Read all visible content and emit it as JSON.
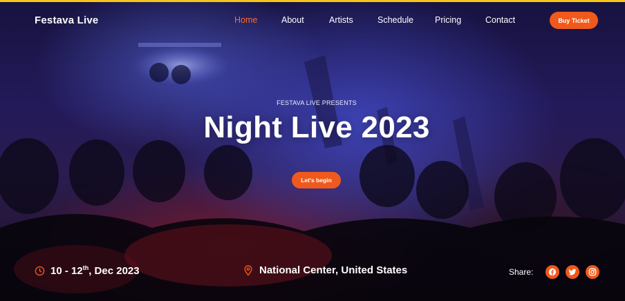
{
  "brand": "Festava Live",
  "nav": [
    {
      "label": "Home",
      "active": true
    },
    {
      "label": "About",
      "active": false
    },
    {
      "label": "Artists",
      "active": false
    },
    {
      "label": "Schedule",
      "active": false
    },
    {
      "label": "Pricing",
      "active": false
    },
    {
      "label": "Contact",
      "active": false
    }
  ],
  "cta": {
    "buy_ticket": "Buy Ticket"
  },
  "hero": {
    "eyebrow": "FESTAVA LIVE PRESENTS",
    "title": "Night Live 2023",
    "button": "Let's begin"
  },
  "event": {
    "date_start": "10 - 12",
    "date_sup": "th",
    "date_end": ", Dec 2023",
    "location": "National Center, United States"
  },
  "share": {
    "label": "Share:",
    "icons": [
      "facebook-icon",
      "twitter-icon",
      "instagram-icon"
    ]
  },
  "colors": {
    "accent": "#f0591c",
    "active_nav": "#ff6a2a",
    "top_bar": "#f4c51a"
  }
}
